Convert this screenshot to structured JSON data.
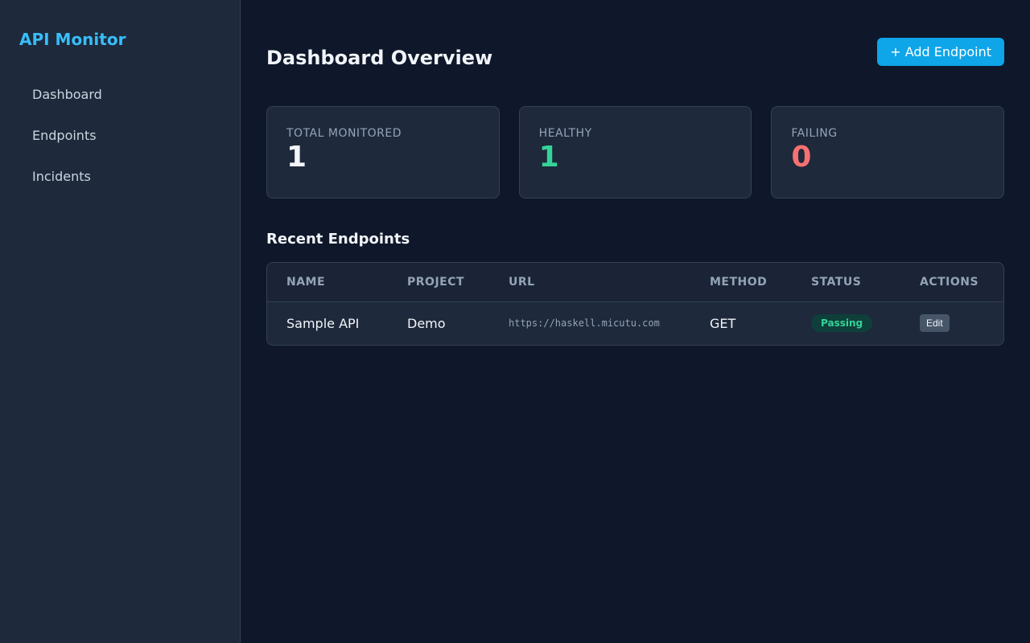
{
  "sidebar": {
    "brand": "API Monitor",
    "items": [
      {
        "label": "Dashboard"
      },
      {
        "label": "Endpoints"
      },
      {
        "label": "Incidents"
      }
    ]
  },
  "header": {
    "title": "Dashboard Overview",
    "add_button": "+ Add Endpoint"
  },
  "stats": [
    {
      "label": "TOTAL MONITORED",
      "value": "1",
      "color": "#f1f5f9"
    },
    {
      "label": "HEALTHY",
      "value": "1",
      "color": "#34d399"
    },
    {
      "label": "FAILING",
      "value": "0",
      "color": "#f87171"
    }
  ],
  "recent": {
    "title": "Recent Endpoints",
    "columns": [
      "NAME",
      "PROJECT",
      "URL",
      "METHOD",
      "STATUS",
      "ACTIONS"
    ],
    "rows": [
      {
        "name": "Sample API",
        "project": "Demo",
        "url": "https://haskell.micutu.com",
        "method": "GET",
        "status": "Passing",
        "action": "Edit"
      }
    ]
  },
  "colors": {
    "accent": "#38bdf8",
    "button": "#0ea5e9",
    "healthy": "#34d399",
    "failing": "#f87171"
  }
}
